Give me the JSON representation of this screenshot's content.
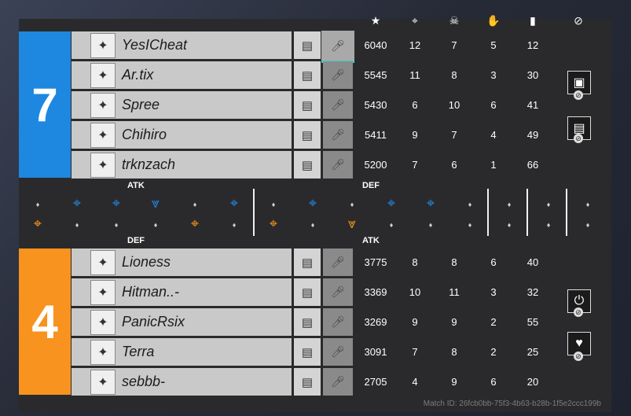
{
  "header_icons": [
    "star-icon",
    "crosshair-icon",
    "skull-icon",
    "assist-icon",
    "signal-icon",
    "ban-icon"
  ],
  "header_glyphs": [
    "★",
    "⌖",
    "☠",
    "✋",
    "▮",
    "⊘"
  ],
  "team_blue": {
    "score": "7",
    "color": "#1e88e0"
  },
  "team_orange": {
    "score": "4",
    "color": "#f7931e"
  },
  "labels": {
    "atk_top": "ATK",
    "def_top": "DEF",
    "def_bottom": "DEF",
    "atk_bottom": "ATK"
  },
  "players_blue": [
    {
      "name": "YesICheat",
      "score": "6040",
      "kills": "12",
      "deaths": "7",
      "assists": "5",
      "ping": "12"
    },
    {
      "name": "Ar.tix",
      "score": "5545",
      "kills": "11",
      "deaths": "8",
      "assists": "3",
      "ping": "30"
    },
    {
      "name": "Spree",
      "score": "5430",
      "kills": "6",
      "deaths": "10",
      "assists": "6",
      "ping": "41"
    },
    {
      "name": "Chihiro",
      "score": "5411",
      "kills": "9",
      "deaths": "7",
      "assists": "4",
      "ping": "49"
    },
    {
      "name": "trknzach",
      "score": "5200",
      "kills": "7",
      "deaths": "6",
      "assists": "1",
      "ping": "66"
    }
  ],
  "players_orange": [
    {
      "name": "Lioness",
      "score": "3775",
      "kills": "8",
      "deaths": "8",
      "assists": "6",
      "ping": "40"
    },
    {
      "name": "Hitman..-",
      "score": "3369",
      "kills": "10",
      "deaths": "11",
      "assists": "3",
      "ping": "32"
    },
    {
      "name": "PanicRsix",
      "score": "3269",
      "kills": "9",
      "deaths": "9",
      "assists": "2",
      "ping": "55"
    },
    {
      "name": "Terra",
      "score": "3091",
      "kills": "7",
      "deaths": "8",
      "assists": "2",
      "ping": "25"
    },
    {
      "name": "sebbb-",
      "score": "2705",
      "kills": "4",
      "deaths": "9",
      "assists": "6",
      "ping": "20"
    }
  ],
  "match_id": "Match ID: 26fcb0bb-75f3-4b63-b28b-1f5e2ccc199b",
  "colors": {
    "blue": "#1e88e0",
    "orange": "#f7931e",
    "highlight": "#41d1c9"
  }
}
